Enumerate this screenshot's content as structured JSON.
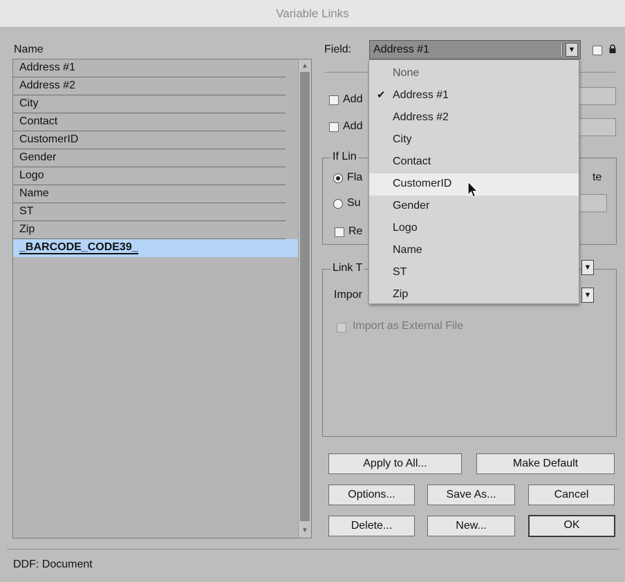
{
  "window": {
    "title": "Variable Links"
  },
  "name_list": {
    "header": "Name",
    "items": [
      "Address #1",
      "Address #2",
      "City",
      "Contact",
      "CustomerID",
      "Gender",
      "Logo",
      "Name",
      "ST",
      "Zip"
    ],
    "selected": "_BARCODE_CODE39_"
  },
  "field": {
    "label": "Field:",
    "selected": "Address #1",
    "options": [
      "None",
      "Address #1",
      "Address #2",
      "City",
      "Contact",
      "CustomerID",
      "Gender",
      "Logo",
      "Name",
      "ST",
      "Zip"
    ],
    "checked_option": "Address #1",
    "hover_option": "CustomerID"
  },
  "options_panel": {
    "add_1_partial": "Add",
    "add_2_partial": "Add",
    "if_link_group_partial": "If Lin",
    "radio_1_partial": "Fla",
    "radio_1_suffix_partial": "te",
    "radio_2_partial": "Su",
    "checkbox_re_partial": "Re",
    "link_group_partial": "Link T",
    "import_label_partial": "Impor",
    "import_external": "Import as External File"
  },
  "buttons": {
    "apply_to_all": "Apply to All...",
    "make_default": "Make Default",
    "options": "Options...",
    "save_as": "Save As...",
    "cancel": "Cancel",
    "delete": "Delete...",
    "new": "New...",
    "ok": "OK"
  },
  "status": {
    "text": "DDF:  Document"
  }
}
